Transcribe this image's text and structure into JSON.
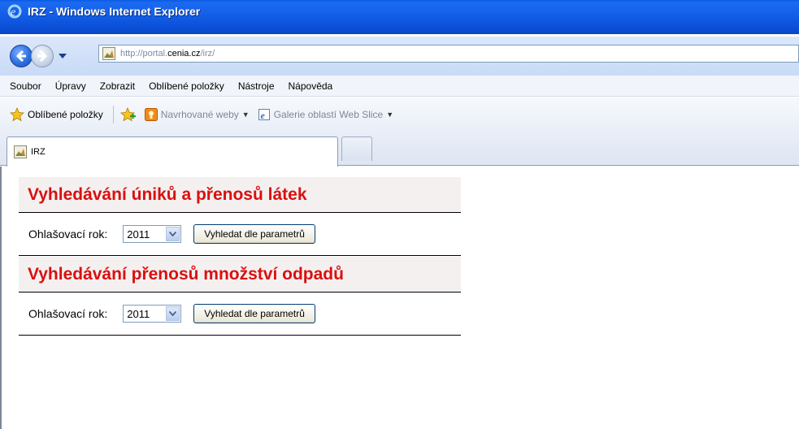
{
  "window": {
    "title": "IRZ - Windows Internet Explorer",
    "icon": "ie-logo-icon"
  },
  "address": {
    "url_prefix": "http://portal.",
    "url_domain": "cenia.cz",
    "url_suffix": "/irz/"
  },
  "menu": {
    "items": [
      "Soubor",
      "Úpravy",
      "Zobrazit",
      "Oblíbené položky",
      "Nástroje",
      "Nápověda"
    ]
  },
  "favorites_bar": {
    "favorites_label": "Oblíbené položky",
    "suggested_sites": "Navrhované weby",
    "web_slice_gallery": "Galerie oblastí Web Slice"
  },
  "tabs": {
    "active_label": "IRZ"
  },
  "sections": [
    {
      "heading": "Vyhledávání úniků a přenosů látek",
      "year_label": "Ohlašovací rok:",
      "year_value": "2011",
      "search_button": "Vyhledat dle parametrů"
    },
    {
      "heading": "Vyhledávání přenosů množství odpadů",
      "year_label": "Ohlašovací rok:",
      "year_value": "2011",
      "search_button": "Vyhledat dle parametrů"
    }
  ],
  "colors": {
    "titlebar": "#1560e8",
    "heading_red": "#d91010"
  }
}
